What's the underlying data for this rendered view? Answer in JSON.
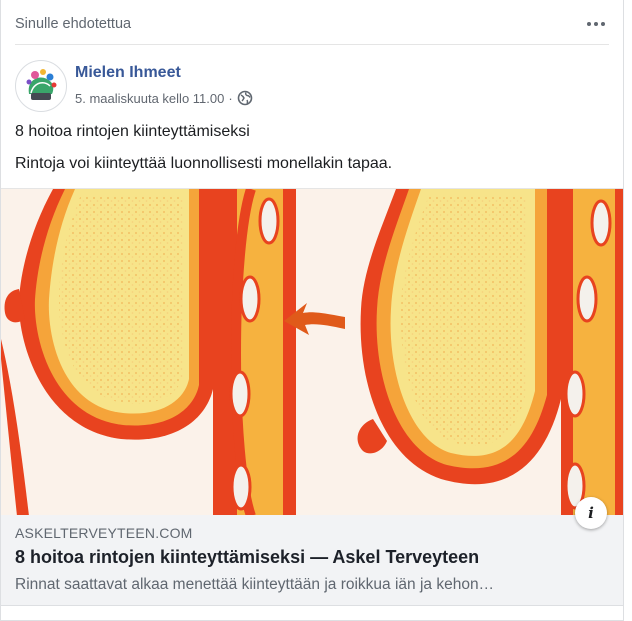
{
  "feed": {
    "suggested_label": "Sinulle ehdotettua",
    "more_icon": "more-horizontal-icon"
  },
  "post": {
    "page_name": "Mielen Ihmeet",
    "date": "5. maaliskuuta kello 11.00",
    "separator": "·",
    "privacy_icon": "globe-icon",
    "title": "8 hoitoa rintojen kiinteyttämiseksi",
    "text": "Rintoja voi kiinteyttää luonnollisesti monellakin tapaa."
  },
  "link": {
    "domain": "ASKELTERVEYTEEN.COM",
    "title": "8 hoitoa rintojen kiinteyttämiseksi — Askel Terveyteen",
    "description": "Rinnat saattavat alkaa menettää kiinteyttään ja roikkua iän ja kehon…",
    "info_label": "i"
  },
  "colors": {
    "accent_link": "#385898",
    "illustration_outer": "#e8431f",
    "illustration_fat": "#f7e48a",
    "arrow": "#e05a1a"
  }
}
